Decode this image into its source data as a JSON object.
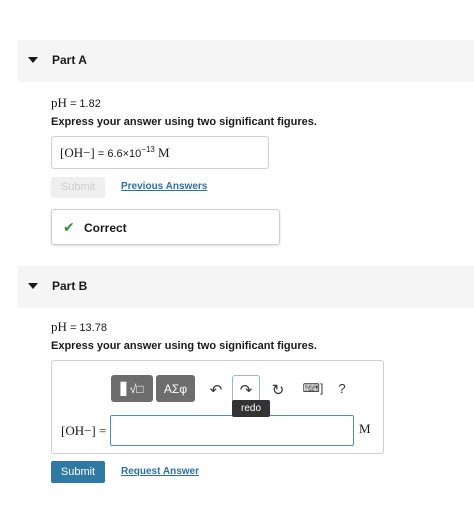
{
  "part_a": {
    "title": "Part A",
    "ph_label": "pH",
    "ph_value": "= 1.82",
    "instruction": "Express your answer using two significant figures.",
    "answer_label": "[OH−]",
    "answer_eq": "=",
    "answer_mantissa": "6.6×10",
    "answer_exponent": "−13",
    "answer_unit": "M",
    "submit_label": "Submit",
    "previous_answers_label": "Previous Answers",
    "feedback": "Correct"
  },
  "part_b": {
    "title": "Part B",
    "ph_label": "pH",
    "ph_value": "= 13.78",
    "instruction": "Express your answer using two significant figures.",
    "toolbar": {
      "templates_label": "▋√□",
      "symbols_label": "ΑΣφ",
      "undo_glyph": "↶",
      "redo_glyph": "↷",
      "reset_glyph": "↻",
      "keyboard_glyph": "⌨]",
      "help_glyph": "?",
      "redo_tooltip": "redo"
    },
    "input_label": "[OH−] =",
    "input_value": "",
    "unit": "M",
    "submit_label": "Submit",
    "request_answer_label": "Request Answer"
  },
  "colors": {
    "accent": "#2f7aa5",
    "link": "#2a6fa8",
    "success": "#3a8a3a",
    "header_bg": "#f5f5f5"
  }
}
